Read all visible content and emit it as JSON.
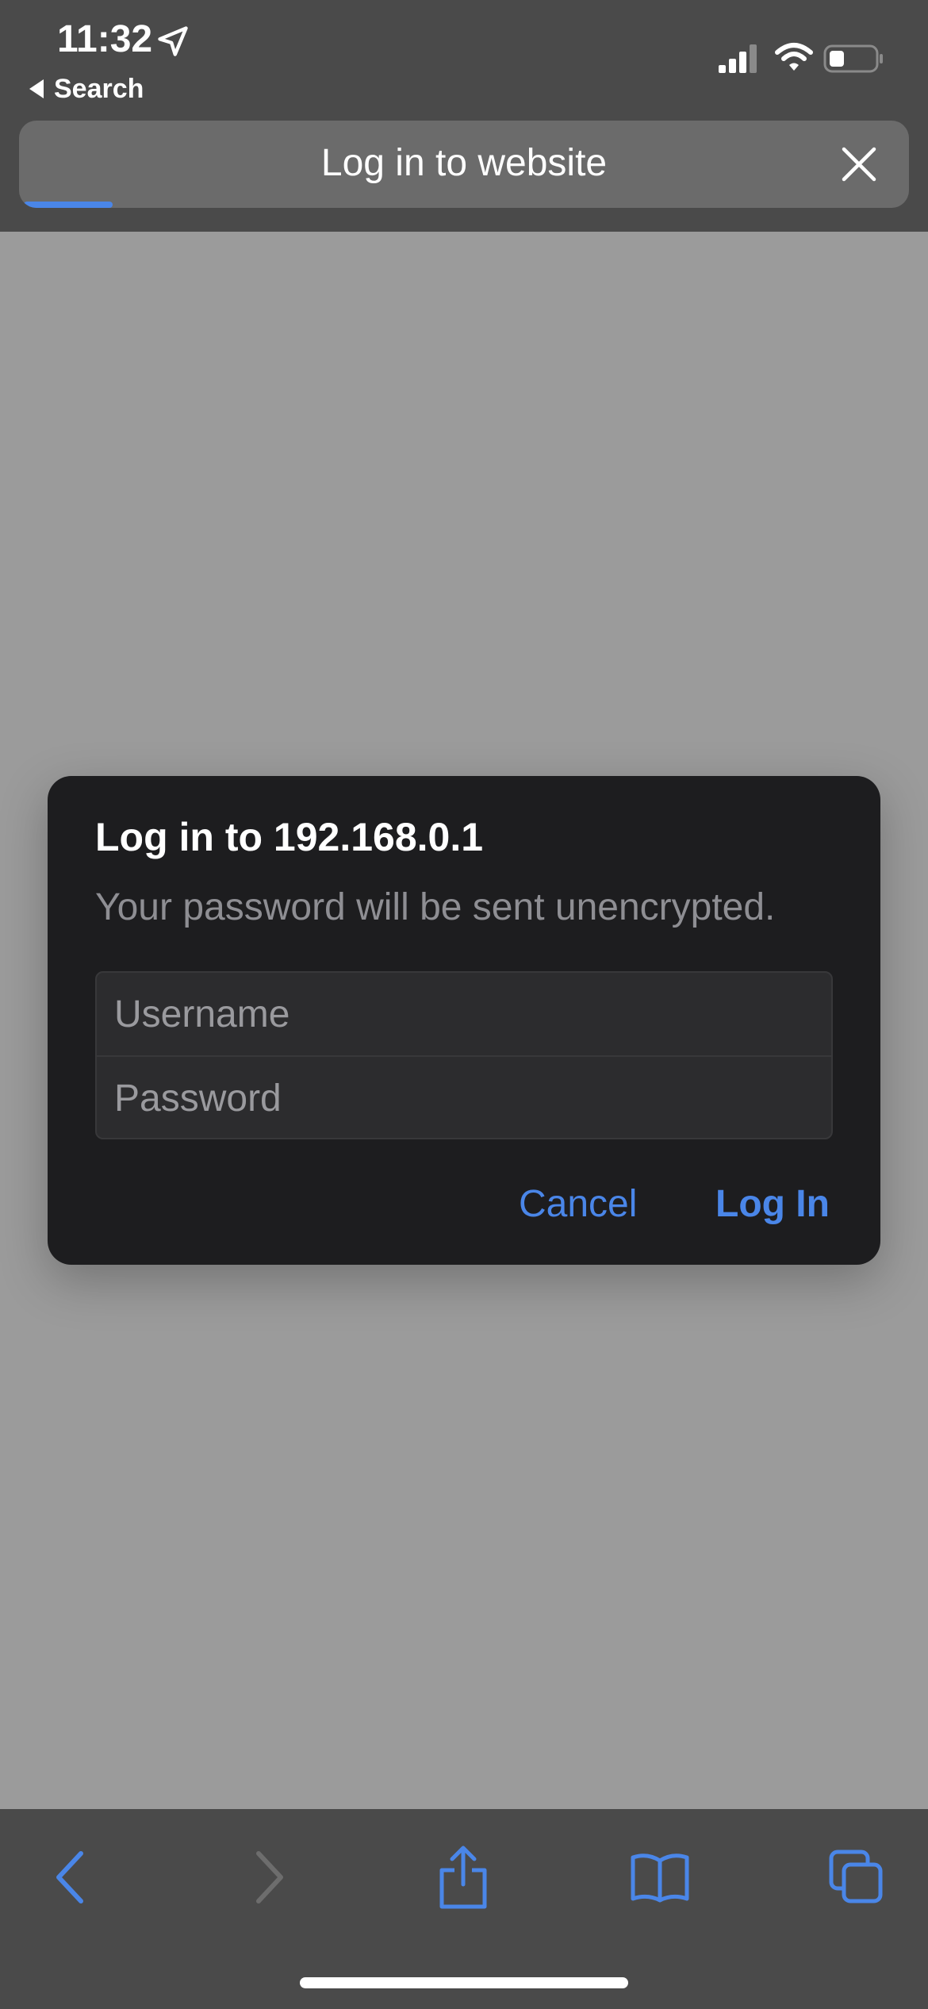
{
  "status_bar": {
    "time": "11:32",
    "back_label": "Search",
    "icons": [
      "location-arrow-icon",
      "signal-icon",
      "wifi-icon",
      "battery-icon"
    ]
  },
  "header": {
    "title": "Log in to website",
    "close_icon": "close-icon",
    "load_progress_percent": 10
  },
  "dialog": {
    "title": "Log in to 192.168.0.1",
    "message": "Your password will be sent unencrypted.",
    "username_placeholder": "Username",
    "password_placeholder": "Password",
    "cancel_label": "Cancel",
    "login_label": "Log In"
  },
  "toolbar": {
    "buttons": [
      "back-icon",
      "forward-icon",
      "share-icon",
      "bookmarks-icon",
      "tabs-icon"
    ]
  },
  "colors": {
    "accent": "#4a86e8",
    "dialog_bg": "#1d1d1f",
    "chrome_bg": "#4a4a4a",
    "page_bg": "#9b9b9b"
  }
}
